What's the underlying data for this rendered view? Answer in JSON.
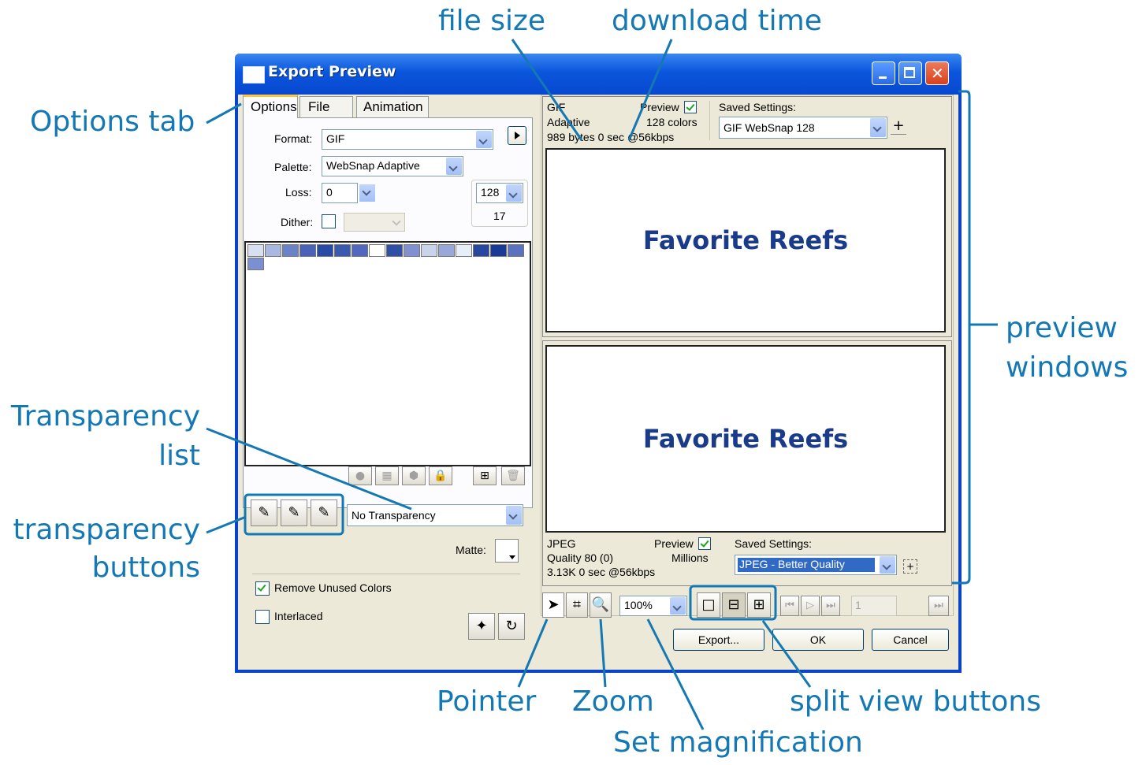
{
  "window": {
    "title": "Export Preview"
  },
  "tabs": [
    {
      "label": "Options"
    },
    {
      "label": "File"
    },
    {
      "label": "Animation"
    }
  ],
  "options": {
    "format_label": "Format:",
    "format_value": "GIF",
    "palette_label": "Palette:",
    "palette_value": "WebSnap Adaptive",
    "loss_label": "Loss:",
    "loss_value": "0",
    "colors_value": "128",
    "colors_count": "17",
    "dither_label": "Dither:",
    "transparency_value": "No Transparency",
    "matte_label": "Matte:",
    "remove_unused_label": "Remove Unused Colors",
    "interlaced_label": "Interlaced",
    "swatch_colors": [
      "#d6e0f0",
      "#a8b8e0",
      "#6a82c8",
      "#4a62b8",
      "#2a4aa8",
      "#3a5ab0",
      "#5068c0",
      "#ffffff",
      "#3050a8",
      "#8090d0",
      "#c8d4ec",
      "#98a8d8",
      "#e8eef8",
      "#2848a0",
      "#1a3a98",
      "#5a72c0",
      "#7a90d0"
    ]
  },
  "preview1": {
    "format": "GIF",
    "palette": "Adaptive",
    "size_time": "989 bytes 0 sec @56kbps",
    "preview_label": "Preview",
    "colors": "128 colors",
    "saved_label": "Saved Settings:",
    "saved_value": "GIF WebSnap 128",
    "image_text": "Favorite Reefs"
  },
  "preview2": {
    "format": "JPEG",
    "quality": "Quality 80 (0)",
    "size_time": "3.13K 0 sec @56kbps",
    "preview_label": "Preview",
    "colors": "Millions",
    "saved_label": "Saved Settings:",
    "saved_value": "JPEG - Better Quality",
    "image_text": "Favorite Reefs"
  },
  "bottom": {
    "zoom_value": "100%",
    "frame_value": "1",
    "export_label": "Export...",
    "ok_label": "OK",
    "cancel_label": "Cancel"
  },
  "annotations": {
    "file_size": "file size",
    "download_time": "download time",
    "options_tab": "Options tab",
    "transparency_list_1": "Transparency",
    "transparency_list_2": "list",
    "transparency_buttons_1": "transparency",
    "transparency_buttons_2": "buttons",
    "preview_windows_1": "preview",
    "preview_windows_2": "windows",
    "pointer": "Pointer",
    "zoom": "Zoom",
    "split_view": "split view buttons",
    "set_magnification": "Set magnification"
  },
  "colors": {
    "annotation": "#1478b4",
    "titlebar": "#0a56dc",
    "preview_text": "#1a3a8a",
    "dialog_bg": "#ece9d8"
  }
}
